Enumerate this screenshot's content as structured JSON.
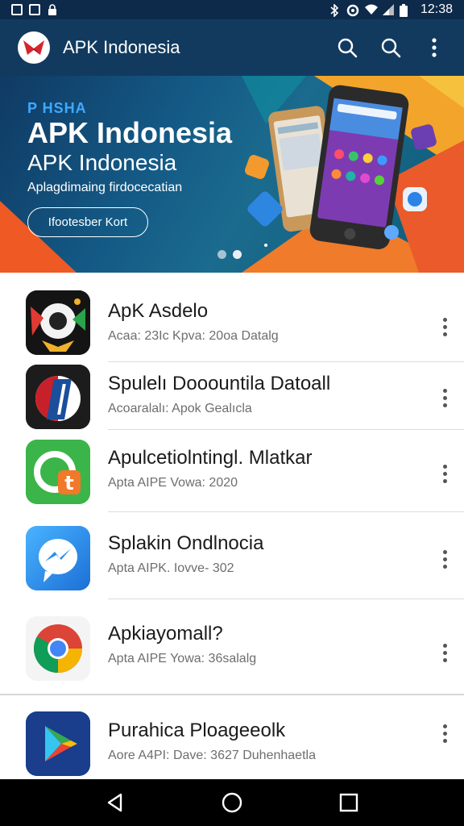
{
  "status_bar": {
    "time": "12:38",
    "icons": [
      "notification-icon",
      "gallery-icon",
      "lock-icon",
      "bluetooth-icon",
      "data-saver-icon",
      "wifi-icon",
      "signal-icon",
      "battery-icon"
    ]
  },
  "app_bar": {
    "title": "APK Indonesia",
    "actions": [
      "search-icon",
      "search-icon",
      "more-vert-icon"
    ],
    "colors": {
      "background": "#123a5f",
      "status": "#0d2a4a"
    }
  },
  "banner": {
    "kicker": "P HSHA",
    "title": "APK Indonesia",
    "subtitle": "APK Indonesia",
    "description": "Aplagdimaing firdocecatian",
    "button_label": "Ifootesber Kort",
    "page_count": 2,
    "active_page": 1
  },
  "apps": [
    {
      "name": "ApK Asdelo",
      "meta": "Acaa: 23Ic  Kpva: 20oa Datalg",
      "icon": "abstract-face-app-icon"
    },
    {
      "name": "Spulelı Dooountila Datoall",
      "meta": "Acoaralalı: Apok Gealıcla",
      "icon": "blue-bar-app-icon"
    },
    {
      "name": "Apulcetiolntingl. Mlatkar",
      "meta": "Apta AIPE  Vowa: 2020",
      "icon": "green-chat-app-icon"
    },
    {
      "name": "Splakin Ondlnocia",
      "meta": "Apta AIPK. Iovve- 302",
      "icon": "messenger-app-icon"
    },
    {
      "name": "Apkiayomall?",
      "meta": "Apta AIPE  Yowa: 36salalg",
      "icon": "chrome-app-icon"
    },
    {
      "name": "Purahica Ploageeolk",
      "meta": "Aore A4PI:  Dave: 3627  Duhenhaetla",
      "icon": "play-store-app-icon"
    }
  ],
  "nav_bar": {
    "buttons": [
      "back-icon",
      "home-icon",
      "recents-icon"
    ]
  }
}
